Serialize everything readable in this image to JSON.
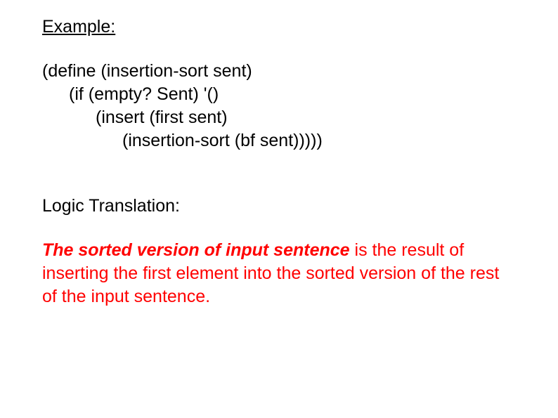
{
  "heading": "Example:",
  "code": {
    "line1": "(define (insertion-sort sent)",
    "line2": "(if (empty? Sent) '()",
    "line3": "(insert (first sent)",
    "line4": "(insertion-sort (bf sent)))))"
  },
  "logicHeading": "Logic Translation:",
  "translation": {
    "emph": "The sorted version of input sentence",
    "rest": " is the result of inserting the first element into the sorted version of the rest of the input sentence."
  }
}
